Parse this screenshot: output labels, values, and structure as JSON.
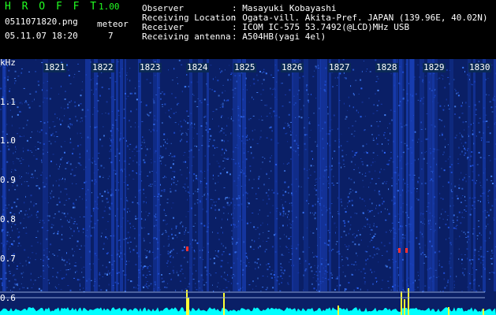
{
  "header": {
    "program_name": "H R O F F T",
    "version": "1.00",
    "filename": "0511071820.png",
    "mode_label": "meteor",
    "datetime": "05.11.07 18:20",
    "meteor_count": "7"
  },
  "info": {
    "rows": [
      {
        "label": "Observer",
        "value": ": Masayuki Kobayashi"
      },
      {
        "label": "Receiving Location",
        "value": ": Ogata-vill. Akita-Pref. JAPAN (139.96E, 40.02N)"
      },
      {
        "label": "Receiver",
        "value": ": ICOM IC-575 53.7492(@LCD)MHz USB"
      },
      {
        "label": "Receiving antenna",
        "value": ": A504HB(yagi 4el)"
      }
    ]
  },
  "spectrogram": {
    "freq_unit": "kHz",
    "time_labels": [
      "1821",
      "1822",
      "1823",
      "1824",
      "1825",
      "1826",
      "1827",
      "1828",
      "1829",
      "1830"
    ],
    "freq_labels": [
      "1.1",
      "1.0",
      "0.9",
      "0.8",
      "0.7",
      "0.6"
    ],
    "colors": {
      "background": "#0a1f66",
      "noise": "#2f6bff",
      "baseline": "#00ffff",
      "spike": "#ffff33",
      "meteor": "#ff3030"
    }
  }
}
